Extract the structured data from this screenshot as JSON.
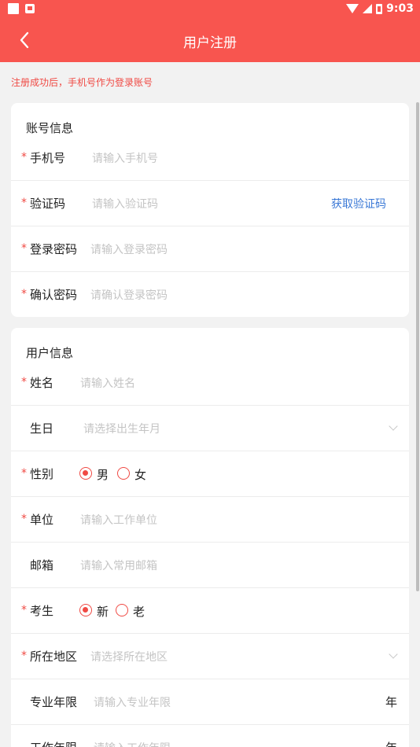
{
  "status_bar": {
    "time": "9:03"
  },
  "app_bar": {
    "title": "用户注册"
  },
  "notice": "注册成功后，手机号作为登录账号",
  "account_section": {
    "title": "账号信息",
    "fields": [
      {
        "label": "手机号",
        "placeholder": "请输入手机号",
        "required": true
      },
      {
        "label": "验证码",
        "placeholder": "请输入验证码",
        "required": true,
        "action": "获取验证码"
      },
      {
        "label": "登录密码",
        "placeholder": "请输入登录密码",
        "required": true
      },
      {
        "label": "确认密码",
        "placeholder": "请确认登录密码",
        "required": true
      }
    ]
  },
  "user_section": {
    "title": "用户信息",
    "name": {
      "label": "姓名",
      "placeholder": "请输入姓名",
      "required": true
    },
    "birthday": {
      "label": "生日",
      "placeholder": "请选择出生年月",
      "required": false
    },
    "gender": {
      "label": "性别",
      "required": true,
      "options": [
        "男",
        "女"
      ],
      "selected": "男"
    },
    "company": {
      "label": "单位",
      "placeholder": "请输入工作单位",
      "required": true
    },
    "email": {
      "label": "邮箱",
      "placeholder": "请输入常用邮箱",
      "required": false
    },
    "candidate": {
      "label": "考生",
      "required": true,
      "options": [
        "新",
        "老"
      ],
      "selected": "新"
    },
    "region": {
      "label": "所在地区",
      "placeholder": "请选择所在地区",
      "required": true
    },
    "professional_years": {
      "label": "专业年限",
      "placeholder": "请输入专业年限",
      "unit": "年",
      "required": false
    },
    "work_years": {
      "label": "工作年限",
      "placeholder": "请输入工作年限",
      "unit": "年",
      "required": false
    }
  },
  "required_mark": "*",
  "colors": {
    "primary": "#f8554f",
    "required": "#f04a44",
    "link": "#3a78d6",
    "placeholder": "#c4c4c4",
    "background": "#f2f2f2"
  }
}
